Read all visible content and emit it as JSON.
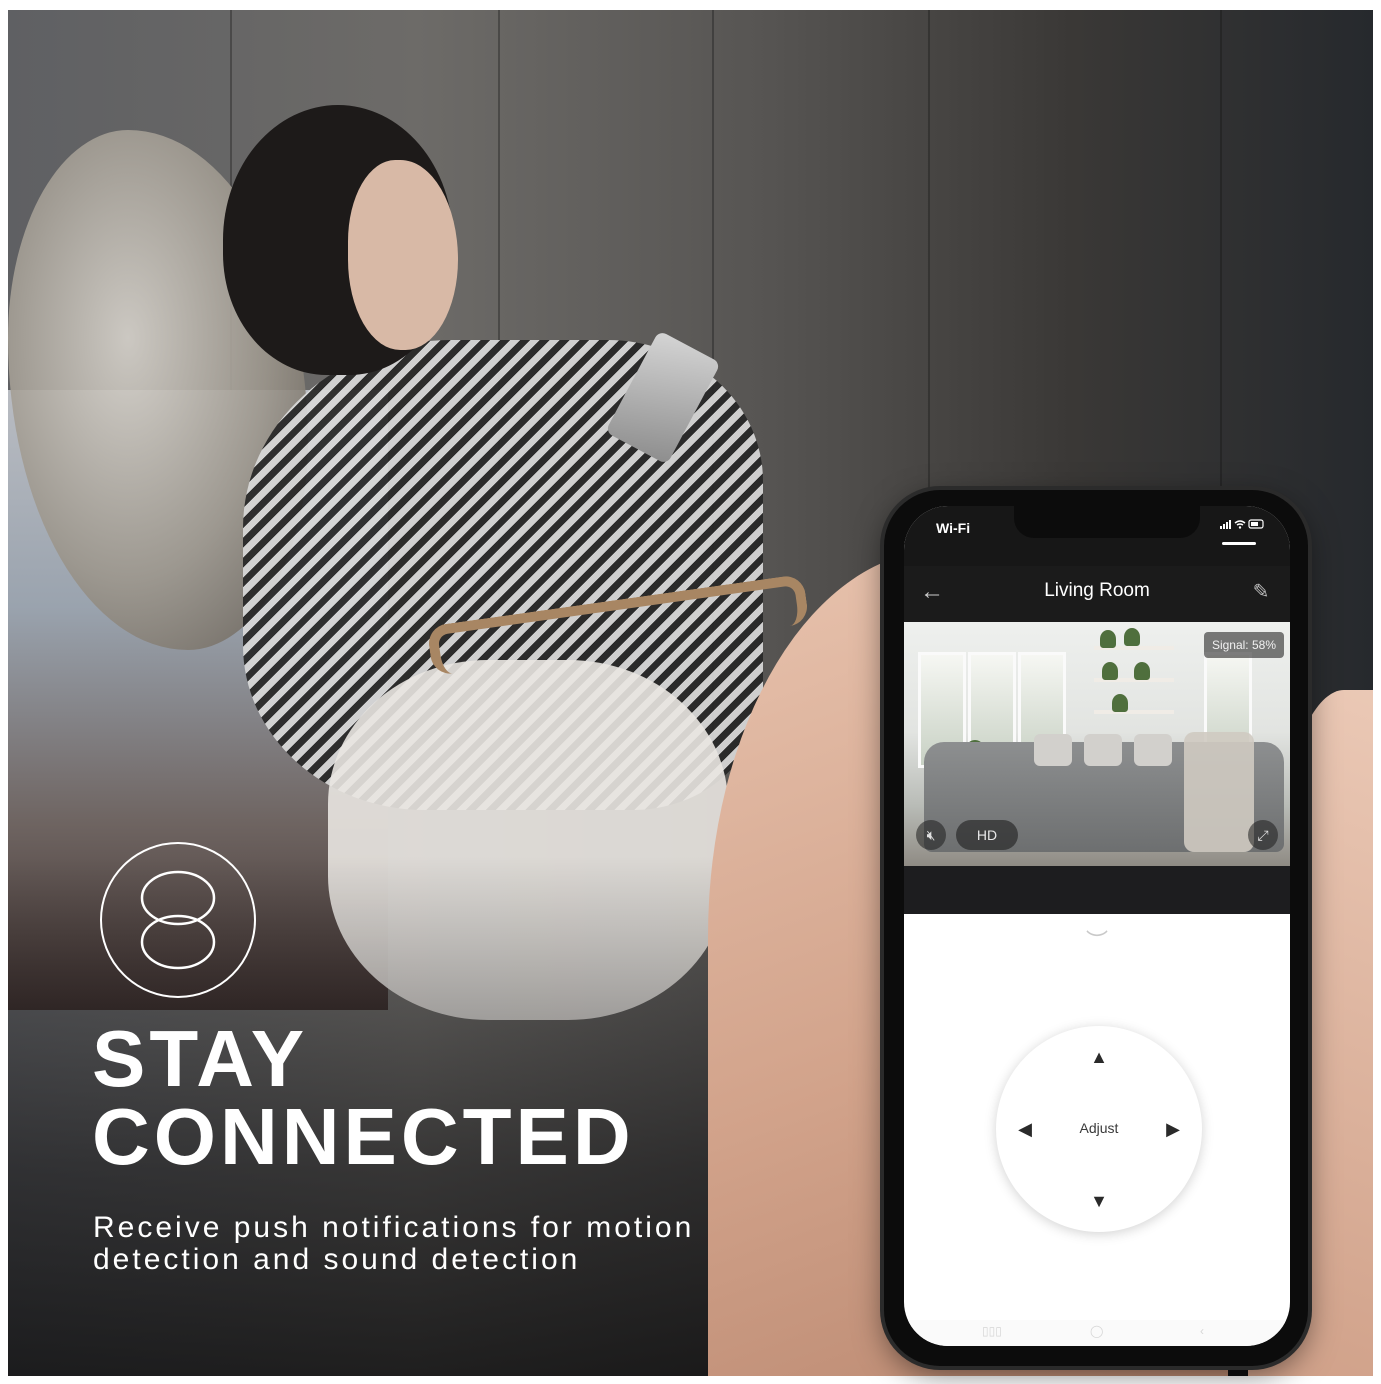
{
  "overlay": {
    "headline_line1": "STAY",
    "headline_line2": "CONNECTED",
    "subtitle_line1": "Receive push notifications for motion",
    "subtitle_line2": "detection and sound detection",
    "logo_icon": "infinity-loop-icon"
  },
  "phone": {
    "status": {
      "carrier": "Wi-Fi",
      "icons": "signal-icon wifi-icon battery-icon"
    },
    "app_bar": {
      "title": "Living Room",
      "back_icon": "arrow-left-icon",
      "edit_icon": "pencil-icon"
    },
    "video": {
      "signal_label": "Signal: 58%",
      "quality_label": "HD",
      "mute_icon": "mute-icon",
      "fullscreen_icon": "fullscreen-icon"
    },
    "controls": {
      "collapse_icon": "chevron-down-icon",
      "dpad_label": "Adjust",
      "up": "▲",
      "down": "▼",
      "left": "◀",
      "right": "▶"
    },
    "nav": {
      "recent": "▯▯▯",
      "home": "◯",
      "back": "‹"
    }
  },
  "colors": {
    "overlay_text": "#ffffff",
    "phone_frame": "#0c0c0c",
    "app_bar": "#1b1b1b"
  }
}
